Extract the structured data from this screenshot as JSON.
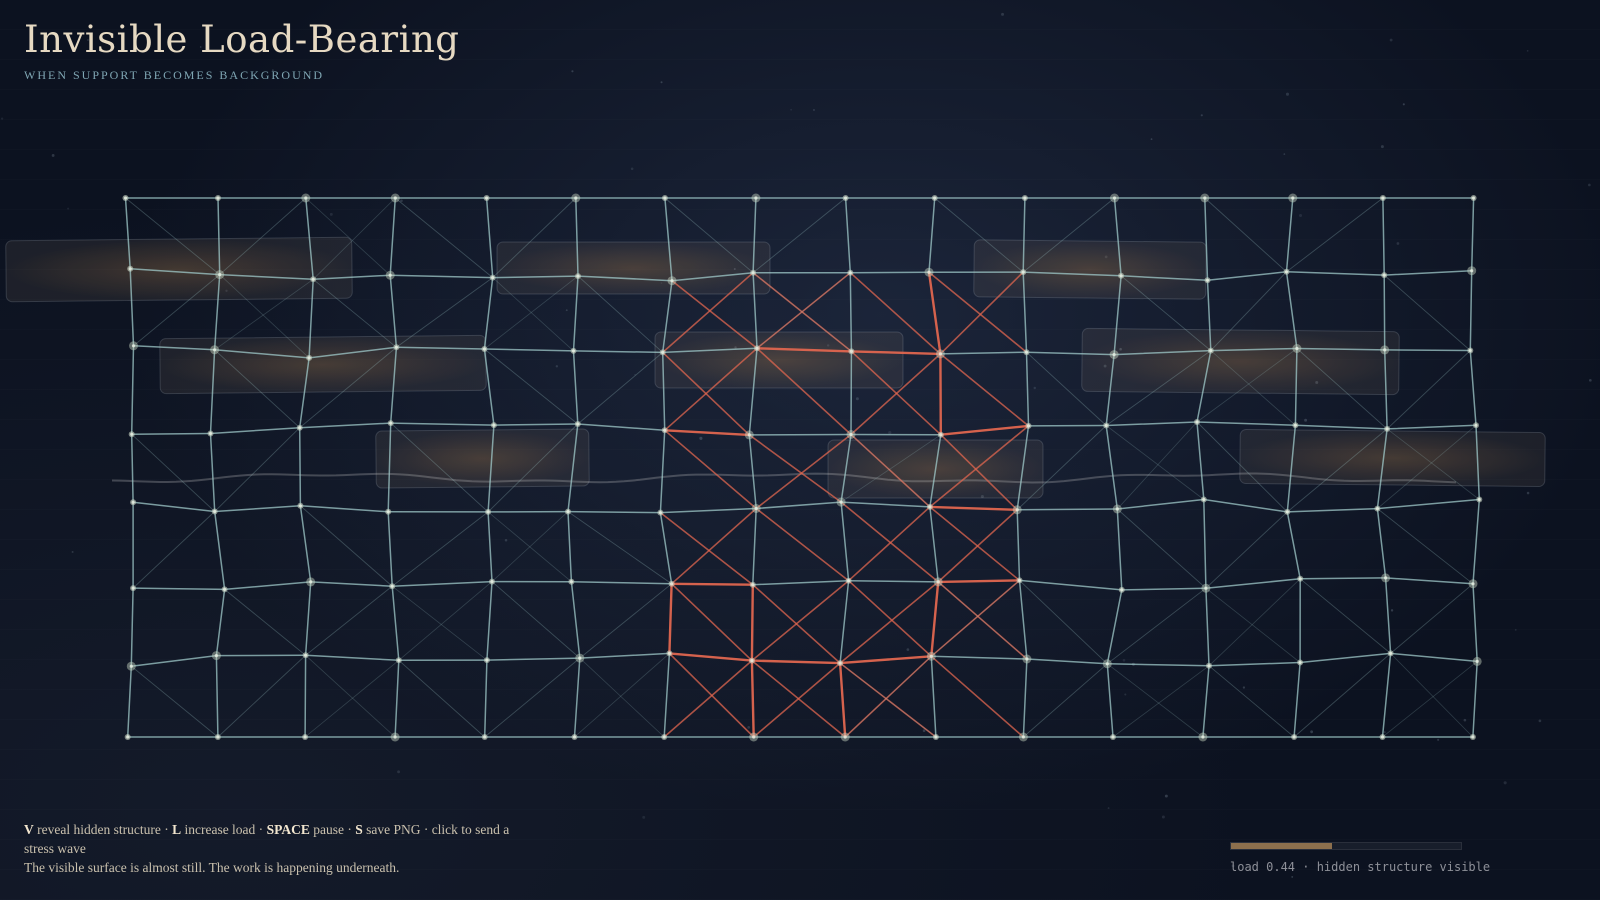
{
  "header": {
    "title": "Invisible Load-Bearing",
    "subtitle": "WHEN SUPPORT BECOMES BACKGROUND"
  },
  "help": {
    "key_v": "V",
    "text_v": " reveal hidden structure · ",
    "key_l": "L",
    "text_l": " increase load · ",
    "key_space": "SPACE",
    "text_space": " pause · ",
    "key_s": "S",
    "text_s": " save PNG · click to send a stress wave",
    "tagline": "The visible surface is almost still. The work is happening underneath."
  },
  "status": {
    "load_value": 0.44,
    "text": "load 0.44 · hidden structure visible"
  },
  "colors": {
    "background": "#0c1220",
    "lattice": "#9fc9c9",
    "stress": "#e0664f",
    "node": "#c9d6c4",
    "panel_glow": "#b07a3e",
    "bar_fill": "#8c6f4d"
  }
}
